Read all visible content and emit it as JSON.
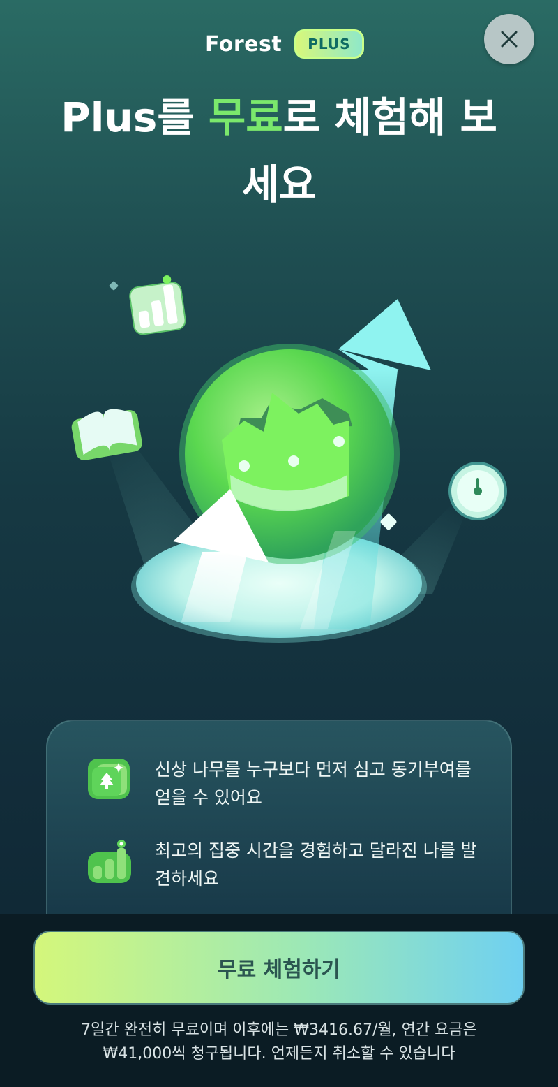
{
  "header": {
    "brand": "Forest",
    "badge": "PLUS",
    "close_icon": "close-icon"
  },
  "headline": {
    "line1_prefix": "Plus를 ",
    "line1_accent": "무료",
    "line1_suffix": "로 체험해 보",
    "line2": "세요"
  },
  "hero": {
    "icons": [
      "bar-chart-icon",
      "book-icon",
      "timer-icon",
      "crown-coin-icon",
      "up-arrow-icon"
    ]
  },
  "features": [
    {
      "icon": "tree-card-icon",
      "text": "신상 나무를 누구보다 먼저 심고 동기부여를 얻을 수 있어요"
    },
    {
      "icon": "bar-chart-icon",
      "text": "최고의 집중 시간을 경험하고 달라진 나를 발견하세요"
    }
  ],
  "cta": {
    "label": "무료 체험하기"
  },
  "legal": {
    "line1": "7일간 완전히 무료이며 이후에는 ₩3416.67/월, 연간 요금은",
    "line2": "₩41,000씩 청구됩니다. 언제든지 취소할 수 있습니다"
  },
  "colors": {
    "accent_green": "#7be86c",
    "cta_start": "#d4f77b",
    "cta_end": "#6fd0f1",
    "badge_text": "#0f6b63"
  }
}
